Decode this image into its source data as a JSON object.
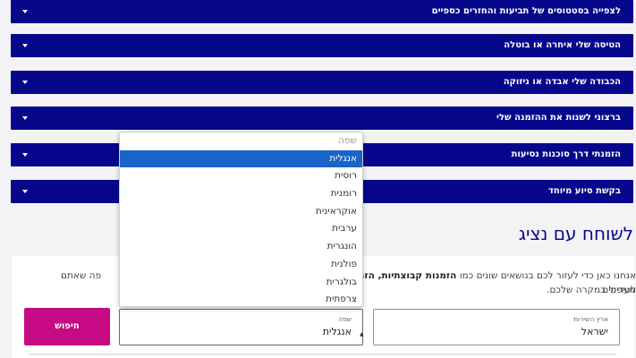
{
  "accordions": [
    {
      "label": "לצפייה בסטטוסים של תביעות והחזרים כספיים"
    },
    {
      "label": "הטיסה שלי איחרה או בוטלה"
    },
    {
      "label": "הכבודה שלי אבדה או ניזוקה"
    },
    {
      "label": "ברצוני לשנות את ההזמנה שלי"
    },
    {
      "label": "הזמנתי דרך סוכנות נסיעות"
    },
    {
      "label": "בקשת סיוע מיוחד"
    }
  ],
  "section_title": "לשוחח עם נציג",
  "intro": {
    "line1_start": "אנחנו כאן כדי לעזור לכם בנושאים שונים כמו",
    "line1_bold": "הזמנות קבוצתיות, הזמנ",
    "line1_end": "פה שאתם מעדיפים",
    "line2": "לטיפול במקרה שלכם."
  },
  "country_field": {
    "label": "ארץ השירות",
    "value": "ישראל"
  },
  "language_field": {
    "label": "שפה",
    "value": "אנגלית",
    "caret": "▲"
  },
  "search_button": {
    "label": "חיפוש"
  },
  "language_dropdown": {
    "placeholder": "שפה",
    "options": [
      "אנגלית",
      "רוסית",
      "רומנית",
      "אוקראינית",
      "ערבית",
      "הונגרית",
      "פולנית",
      "בולגרית",
      "צרפתית"
    ],
    "selected_index": 0
  },
  "colors": {
    "accordion_bg": "#07078c",
    "title": "#07078c",
    "search_button": "#c50a83",
    "selected_option": "#1a63c9"
  }
}
